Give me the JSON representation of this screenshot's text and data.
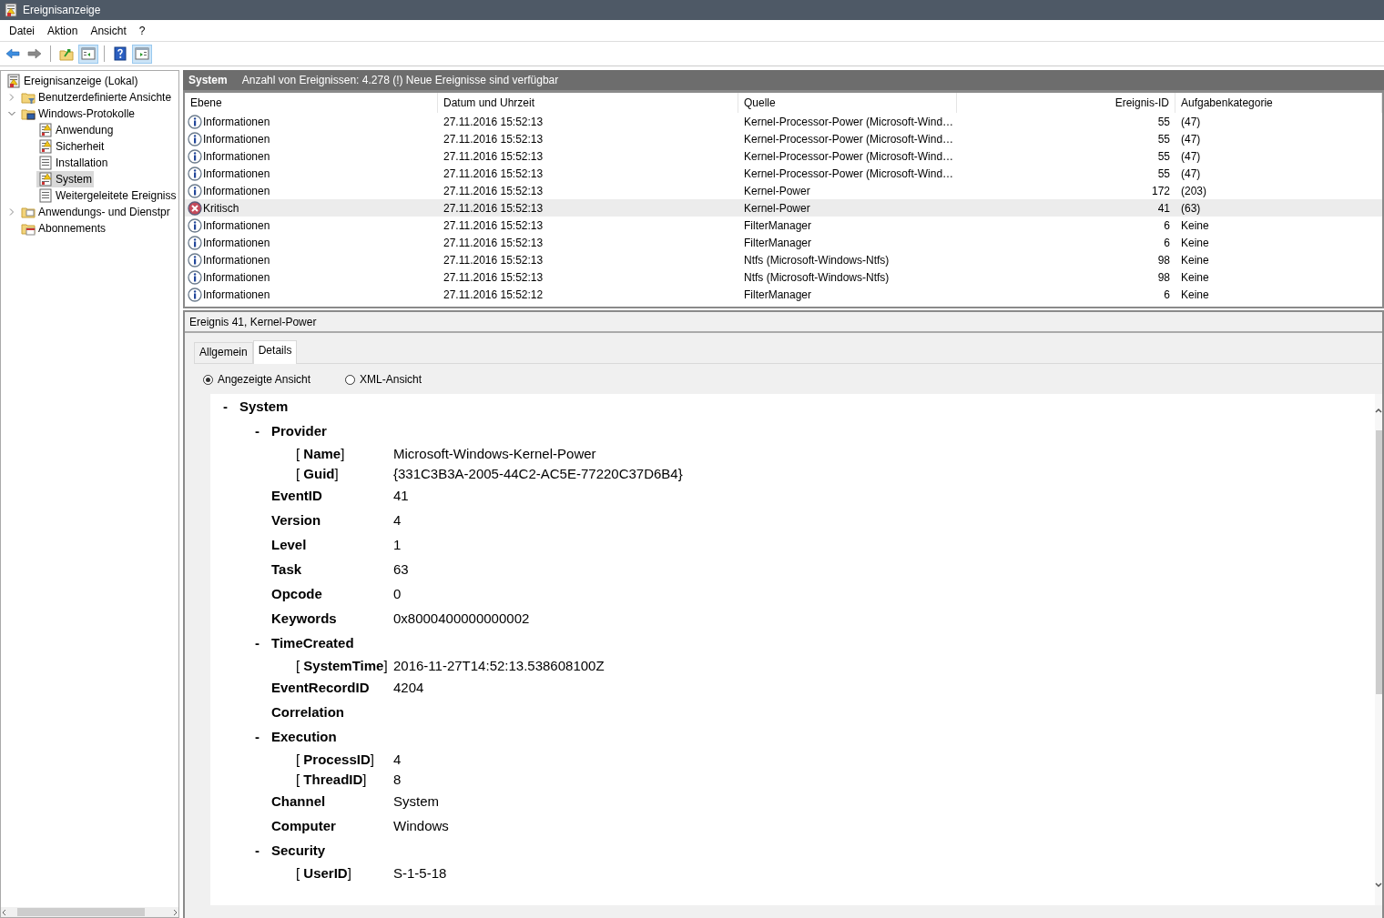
{
  "window": {
    "title": "Ereignisanzeige"
  },
  "menu": [
    "Datei",
    "Aktion",
    "Ansicht",
    "?"
  ],
  "toolbar": [
    {
      "kind": "back",
      "on": false
    },
    {
      "kind": "forward",
      "on": false
    },
    {
      "kind": "up",
      "on": false
    },
    {
      "kind": "pane-left",
      "on": true
    },
    {
      "kind": "help",
      "on": false
    },
    {
      "kind": "pane-right",
      "on": true
    }
  ],
  "tree": {
    "label": "Ereignisanzeige (Lokal)",
    "kind": "viewer",
    "selected": false,
    "children": [
      {
        "label": "Benutzerdefinierte Ansichte",
        "kind": "filter-folder",
        "expanded": false,
        "selected": false
      },
      {
        "label": "Windows-Protokolle",
        "kind": "monitor-folder",
        "expanded": true,
        "selected": false,
        "children": [
          {
            "label": "Anwendung",
            "kind": "log-alert",
            "selected": false
          },
          {
            "label": "Sicherheit",
            "kind": "log-alert",
            "selected": false
          },
          {
            "label": "Installation",
            "kind": "log",
            "selected": false
          },
          {
            "label": "System",
            "kind": "log-alert",
            "selected": true
          },
          {
            "label": "Weitergeleitete Ereigniss",
            "kind": "log",
            "selected": false
          }
        ]
      },
      {
        "label": "Anwendungs- und Dienstpr",
        "kind": "folder",
        "expanded": false,
        "selected": false
      },
      {
        "label": "Abonnements",
        "kind": "calendar-folder",
        "selected": false
      }
    ]
  },
  "log_header": {
    "name": "System",
    "summary": "Anzahl von Ereignissen: 4.278 (!) Neue Ereignisse sind verfügbar"
  },
  "table": {
    "columns": [
      "Ebene",
      "Datum und Uhrzeit",
      "Quelle",
      "Ereignis-ID",
      "Aufgabenkategorie"
    ],
    "rows": [
      {
        "kind": "info",
        "label": "Informationen",
        "date": "27.11.2016 15:52:13",
        "source": "Kernel-Processor-Power (Microsoft-Wind…",
        "id": "55",
        "category": "(47)",
        "selected": false
      },
      {
        "kind": "info",
        "label": "Informationen",
        "date": "27.11.2016 15:52:13",
        "source": "Kernel-Processor-Power (Microsoft-Wind…",
        "id": "55",
        "category": "(47)",
        "selected": false
      },
      {
        "kind": "info",
        "label": "Informationen",
        "date": "27.11.2016 15:52:13",
        "source": "Kernel-Processor-Power (Microsoft-Wind…",
        "id": "55",
        "category": "(47)",
        "selected": false
      },
      {
        "kind": "info",
        "label": "Informationen",
        "date": "27.11.2016 15:52:13",
        "source": "Kernel-Processor-Power (Microsoft-Wind…",
        "id": "55",
        "category": "(47)",
        "selected": false
      },
      {
        "kind": "info",
        "label": "Informationen",
        "date": "27.11.2016 15:52:13",
        "source": "Kernel-Power",
        "id": "172",
        "category": "(203)",
        "selected": false
      },
      {
        "kind": "critical",
        "label": "Kritisch",
        "date": "27.11.2016 15:52:13",
        "source": "Kernel-Power",
        "id": "41",
        "category": "(63)",
        "selected": true
      },
      {
        "kind": "info",
        "label": "Informationen",
        "date": "27.11.2016 15:52:13",
        "source": "FilterManager",
        "id": "6",
        "category": "Keine",
        "selected": false
      },
      {
        "kind": "info",
        "label": "Informationen",
        "date": "27.11.2016 15:52:13",
        "source": "FilterManager",
        "id": "6",
        "category": "Keine",
        "selected": false
      },
      {
        "kind": "info",
        "label": "Informationen",
        "date": "27.11.2016 15:52:13",
        "source": "Ntfs (Microsoft-Windows-Ntfs)",
        "id": "98",
        "category": "Keine",
        "selected": false
      },
      {
        "kind": "info",
        "label": "Informationen",
        "date": "27.11.2016 15:52:13",
        "source": "Ntfs (Microsoft-Windows-Ntfs)",
        "id": "98",
        "category": "Keine",
        "selected": false
      },
      {
        "kind": "info",
        "label": "Informationen",
        "date": "27.11.2016 15:52:12",
        "source": "FilterManager",
        "id": "6",
        "category": "Keine",
        "selected": false
      }
    ]
  },
  "details": {
    "title": "Ereignis 41, Kernel-Power",
    "tabs": [
      {
        "label": "Allgemein",
        "selected": false
      },
      {
        "label": "Details",
        "selected": true
      }
    ],
    "views": [
      {
        "label": "Angezeigte Ansicht",
        "selected": true
      },
      {
        "label": "XML-Ansicht",
        "selected": false
      }
    ],
    "tree": [
      {
        "kind": "group",
        "toggle": "-",
        "label": "System",
        "children": [
          {
            "kind": "group",
            "toggle": "-",
            "label": "Provider",
            "children": [
              {
                "kind": "attribute",
                "label": "[ **Name**]",
                "value": "Microsoft-Windows-Kernel-Power"
              },
              {
                "kind": "attribute",
                "label": "[ **Guid**]",
                "value": "{331C3B3A-2005-44C2-AC5E-77220C37D6B4}"
              }
            ]
          },
          {
            "kind": "field",
            "label": "EventID",
            "value": "41"
          },
          {
            "kind": "field",
            "label": "Version",
            "value": "4"
          },
          {
            "kind": "field",
            "label": "Level",
            "value": "1"
          },
          {
            "kind": "field",
            "label": "Task",
            "value": "63"
          },
          {
            "kind": "field",
            "label": "Opcode",
            "value": "0"
          },
          {
            "kind": "field",
            "label": "Keywords",
            "value": "0x8000400000000002"
          },
          {
            "kind": "group",
            "toggle": "-",
            "label": "TimeCreated",
            "children": [
              {
                "kind": "attribute",
                "label": "[ **SystemTime**]",
                "value": "2016-11-27T14:52:13.538608100Z"
              }
            ]
          },
          {
            "kind": "field",
            "label": "EventRecordID",
            "value": "4204"
          },
          {
            "kind": "field",
            "label": "Correlation"
          },
          {
            "kind": "group",
            "toggle": "-",
            "label": "Execution",
            "children": [
              {
                "kind": "attribute",
                "label": "[ **ProcessID**]",
                "value": "4"
              },
              {
                "kind": "attribute",
                "label": "[ **ThreadID**]",
                "value": "8"
              }
            ]
          },
          {
            "kind": "field",
            "label": "Channel",
            "value": "System"
          },
          {
            "kind": "field",
            "label": "Computer",
            "value": "Windows"
          },
          {
            "kind": "group",
            "toggle": "-",
            "label": "Security",
            "children": [
              {
                "kind": "attribute",
                "label": "[ **UserID**]",
                "value": "S-1-5-18"
              }
            ]
          }
        ]
      }
    ]
  }
}
